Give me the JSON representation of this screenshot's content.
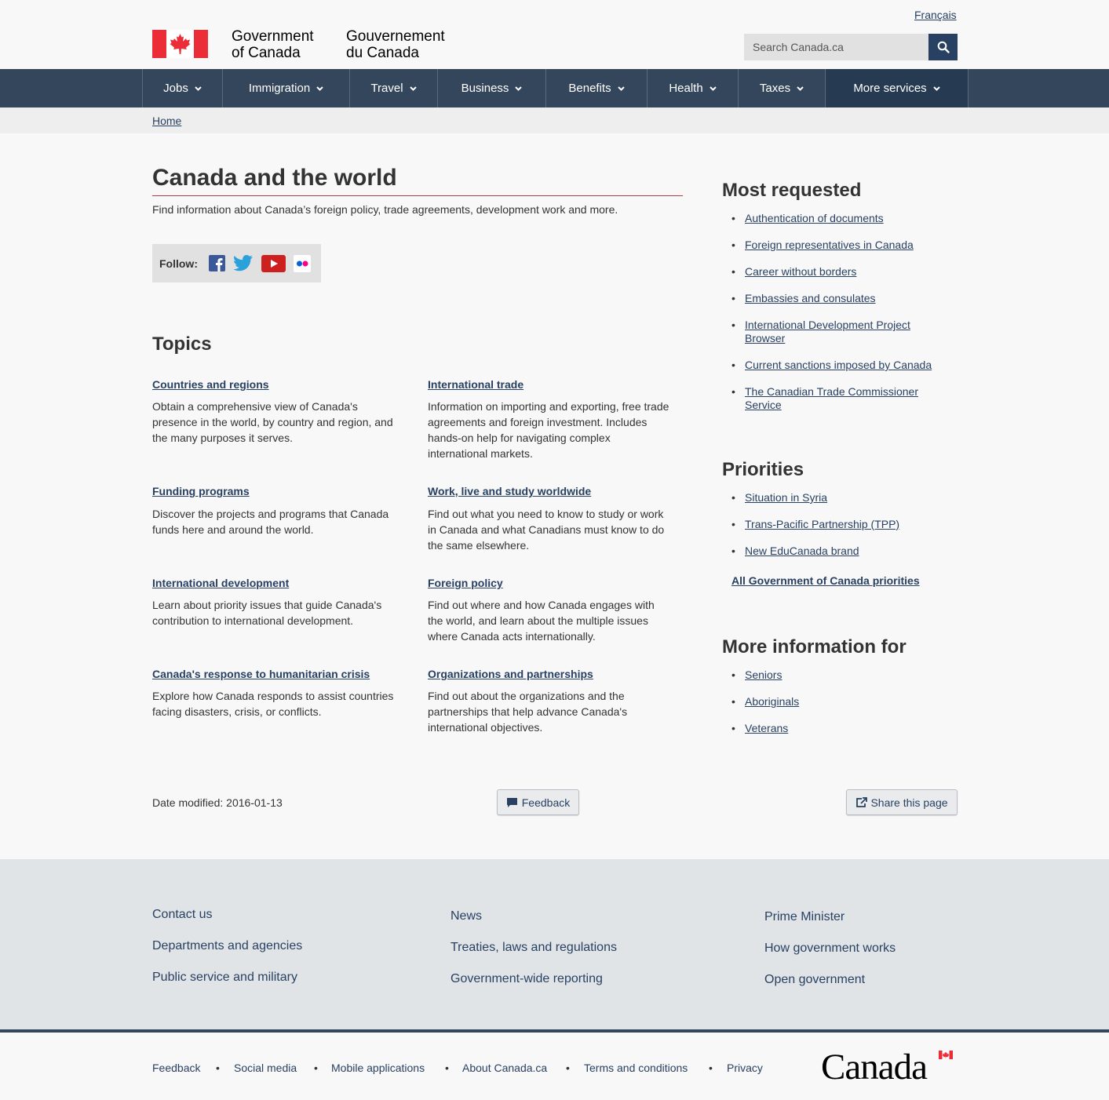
{
  "header": {
    "lang_toggle": "Français",
    "signature_en": [
      "Government",
      "of Canada"
    ],
    "signature_fr": [
      "Gouvernement",
      "du Canada"
    ],
    "search_placeholder": "Search Canada.ca",
    "search_icon": "search-icon"
  },
  "menu": {
    "items": [
      {
        "label": "Jobs"
      },
      {
        "label": "Immigration"
      },
      {
        "label": "Travel"
      },
      {
        "label": "Business"
      },
      {
        "label": "Benefits"
      },
      {
        "label": "Health"
      },
      {
        "label": "Taxes"
      },
      {
        "label": "More services"
      }
    ]
  },
  "breadcrumb": {
    "home": "Home"
  },
  "main": {
    "title": "Canada and the world",
    "intro": "Find information about Canada’s foreign policy, trade agreements, development work and more.",
    "follow_label": "Follow:",
    "social_icons": [
      "facebook-icon",
      "twitter-icon",
      "youtube-icon",
      "flickr-icon"
    ],
    "topics_title": "Topics",
    "topics": [
      {
        "title": "Countries and regions",
        "desc": [
          "Obtain a comprehensive view of Canada's",
          "presence in the world, by country and region, and",
          "the many purposes it serves."
        ]
      },
      {
        "title": "International trade",
        "desc": [
          "Information on importing and exporting, free trade",
          "agreements and foreign investment. Includes",
          "hands-on help for navigating complex",
          "international markets."
        ]
      },
      {
        "title": "Funding programs",
        "desc": [
          "Discover the projects and programs that Canada",
          "funds here and around the world."
        ]
      },
      {
        "title": "Work, live and study worldwide",
        "desc": [
          "Find out what you need to know to study or work",
          "in Canada and what Canadians must know to do",
          "the same elsewhere."
        ]
      },
      {
        "title": "International development",
        "desc": [
          "Learn about priority issues that guide Canada's",
          "contribution to international development."
        ]
      },
      {
        "title": "Foreign policy",
        "desc": [
          "Find out where and how Canada engages with",
          "the world, and learn about the multiple issues",
          "where Canada acts internationally."
        ]
      },
      {
        "title": "Canada's response to humanitarian crisis",
        "desc": [
          "Explore how Canada responds to assist countries",
          "facing disasters, crisis, or conflicts."
        ]
      },
      {
        "title": "Organizations and partnerships",
        "desc": [
          "Find out about the organizations and the",
          "partnerships that help advance Canada's",
          "international objectives."
        ]
      }
    ],
    "date_modified_label": "Date modified:",
    "date_modified": "2016-01-13",
    "feedback_button": "Feedback",
    "share_button": "Share this page"
  },
  "sidebar": {
    "most_requested_title": "Most requested",
    "most_requested": [
      [
        "Authentication of documents"
      ],
      [
        "Foreign representatives in Canada"
      ],
      [
        "Career without borders"
      ],
      [
        "Embassies and consulates"
      ],
      [
        "International Development Project",
        "Browser"
      ],
      [
        "Current sanctions imposed by Canada"
      ],
      [
        "The Canadian Trade Commissioner",
        "Service"
      ]
    ],
    "priorities_title": "Priorities",
    "priorities": [
      "Situation in Syria",
      "Trans-Pacific Partnership (TPP)",
      "New EduCanada brand"
    ],
    "all_priorities": "All Government of Canada priorities",
    "more_info_title": "More information for",
    "more_info": [
      "Seniors",
      "Aboriginals",
      "Veterans"
    ]
  },
  "footer": {
    "col1": [
      "Contact us",
      "Departments and agencies",
      "Public service and military"
    ],
    "col2": [
      "News",
      "Treaties, laws and regulations",
      "Government-wide reporting"
    ],
    "col3": [
      "Prime Minister",
      "How government works",
      "Open government"
    ],
    "sub_links": [
      "Feedback",
      "Social media",
      "Mobile applications",
      "About Canada.ca",
      "Terms and conditions",
      "Privacy"
    ],
    "wordmark": "Canada"
  },
  "colors": {
    "menu_bg": "#33465c",
    "link": "#284162",
    "flag_red": "#eb2d37",
    "rule_red": "#af3c43"
  }
}
